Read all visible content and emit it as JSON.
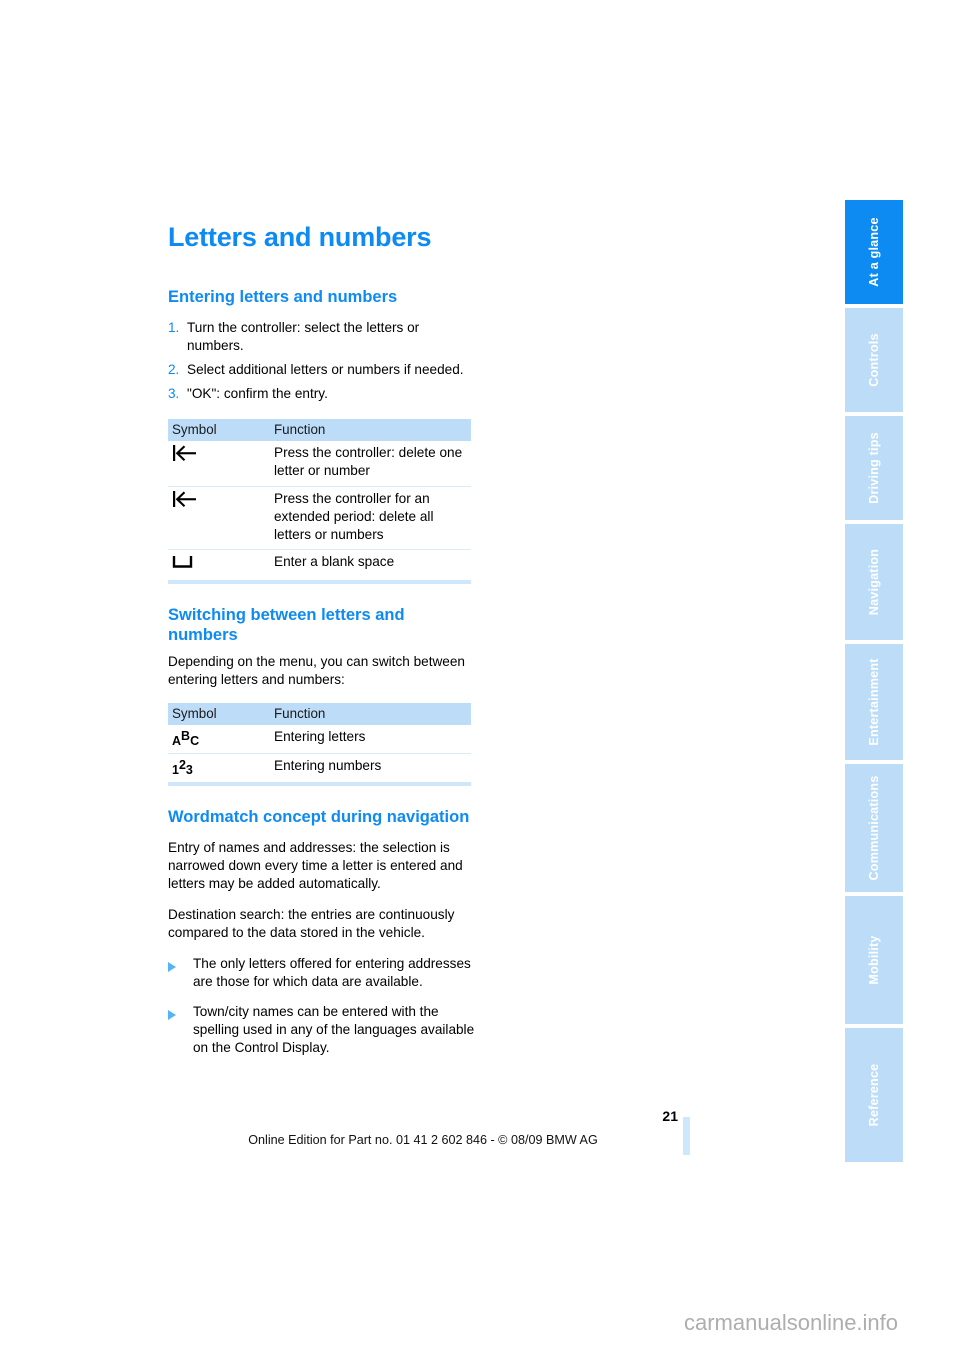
{
  "page": {
    "title": "Letters and numbers",
    "number": "21",
    "edition_line": "Online Edition for Part no. 01 41 2 602 846 - © 08/09 BMW AG",
    "watermark": "carmanualsonline.info",
    "accent_color": "#0d8bf2",
    "tab_inactive_color": "#bcdcf8",
    "table_header_color": "#bcdcf8"
  },
  "sections": {
    "entering": {
      "heading": "Entering letters and numbers",
      "steps": [
        {
          "num": "1.",
          "text": "Turn the controller: select the letters or numbers."
        },
        {
          "num": "2.",
          "text": "Select additional letters or numbers if needed."
        },
        {
          "num": "3.",
          "text": "\"OK\": confirm the entry."
        }
      ],
      "table": {
        "headers": [
          "Symbol",
          "Function"
        ],
        "rows": [
          {
            "symbol": "backspace-arrow-icon",
            "function": "Press the controller: delete one letter or number"
          },
          {
            "symbol": "backspace-arrow-icon",
            "function": "Press the controller for an extended period: delete all letters or numbers"
          },
          {
            "symbol": "blank-space-icon",
            "function": "Enter a blank space"
          }
        ]
      }
    },
    "switching": {
      "heading_line1": "Switching between letters and",
      "heading_line2": "numbers",
      "paragraph": "Depending on the menu, you can switch between entering letters and numbers:",
      "table": {
        "headers": [
          "Symbol",
          "Function"
        ],
        "rows": [
          {
            "symbol_low1": "A",
            "symbol_high": "B",
            "symbol_low2": "C",
            "function": "Entering letters"
          },
          {
            "symbol_low1": "1",
            "symbol_high": "2",
            "symbol_low2": "3",
            "function": "Entering numbers"
          }
        ]
      }
    },
    "wordmatch": {
      "heading": "Wordmatch concept during navigation",
      "paragraphs": [
        "Entry of names and addresses: the selection is narrowed down every time a letter is entered and letters may be added automatically.",
        "Destination search: the entries are continuously compared to the data stored in the vehicle."
      ],
      "bullets": [
        "The only letters offered for entering addresses are those for which data are available.",
        "Town/city names can be entered with the spelling used in any of the languages available on the Control Display."
      ]
    }
  },
  "side_tabs": [
    {
      "label": "At a glance",
      "active": true
    },
    {
      "label": "Controls",
      "active": false
    },
    {
      "label": "Driving tips",
      "active": false
    },
    {
      "label": "Navigation",
      "active": false
    },
    {
      "label": "Entertainment",
      "active": false
    },
    {
      "label": "Communications",
      "active": false
    },
    {
      "label": "Mobility",
      "active": false
    },
    {
      "label": "Reference",
      "active": false
    }
  ]
}
